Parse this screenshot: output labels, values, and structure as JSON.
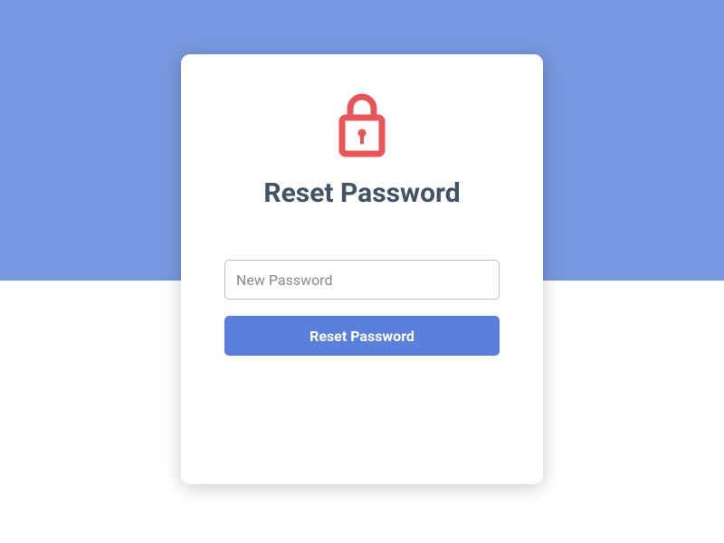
{
  "card": {
    "title": "Reset Password",
    "password_placeholder": "New Password",
    "submit_label": "Reset Password"
  }
}
